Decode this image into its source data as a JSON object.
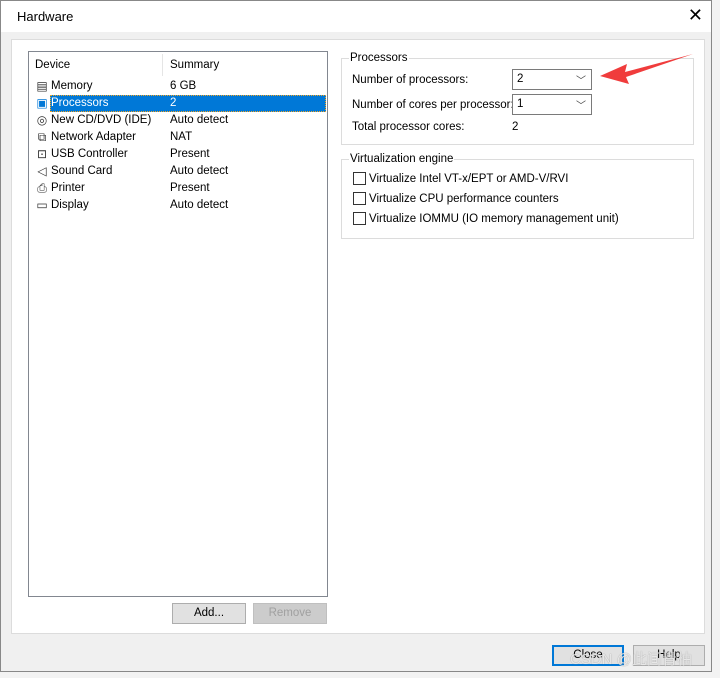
{
  "dialog": {
    "title": "Hardware",
    "close_icon": "close-icon"
  },
  "devices": {
    "headers": {
      "device": "Device",
      "summary": "Summary"
    },
    "items": [
      {
        "name": "Memory",
        "summary": "6 GB",
        "icon": "memory-icon"
      },
      {
        "name": "Processors",
        "summary": "2",
        "icon": "processor-icon",
        "selected": true
      },
      {
        "name": "New CD/DVD (IDE)",
        "summary": "Auto detect",
        "icon": "cd-icon"
      },
      {
        "name": "Network Adapter",
        "summary": "NAT",
        "icon": "network-icon"
      },
      {
        "name": "USB Controller",
        "summary": "Present",
        "icon": "usb-icon"
      },
      {
        "name": "Sound Card",
        "summary": "Auto detect",
        "icon": "sound-icon"
      },
      {
        "name": "Printer",
        "summary": "Present",
        "icon": "printer-icon"
      },
      {
        "name": "Display",
        "summary": "Auto detect",
        "icon": "display-icon"
      }
    ]
  },
  "buttons": {
    "add": "Add...",
    "remove": "Remove",
    "close": "Close",
    "help": "Help"
  },
  "processors": {
    "group": "Processors",
    "num_label": "Number of processors:",
    "num_value": "2",
    "cores_label": "Number of cores per processor:",
    "cores_value": "1",
    "total_label": "Total processor cores:",
    "total_value": "2"
  },
  "virtualization": {
    "group": "Virtualization engine",
    "options": [
      {
        "label": "Virtualize Intel VT-x/EPT or AMD-V/RVI",
        "checked": false
      },
      {
        "label": "Virtualize CPU performance counters",
        "checked": false
      },
      {
        "label": "Virtualize IOMMU (IO memory management unit)",
        "checked": false
      }
    ]
  },
  "watermark": "CSDN @此间青柚",
  "annotation": {
    "arrow_color": "#f03c3c"
  }
}
